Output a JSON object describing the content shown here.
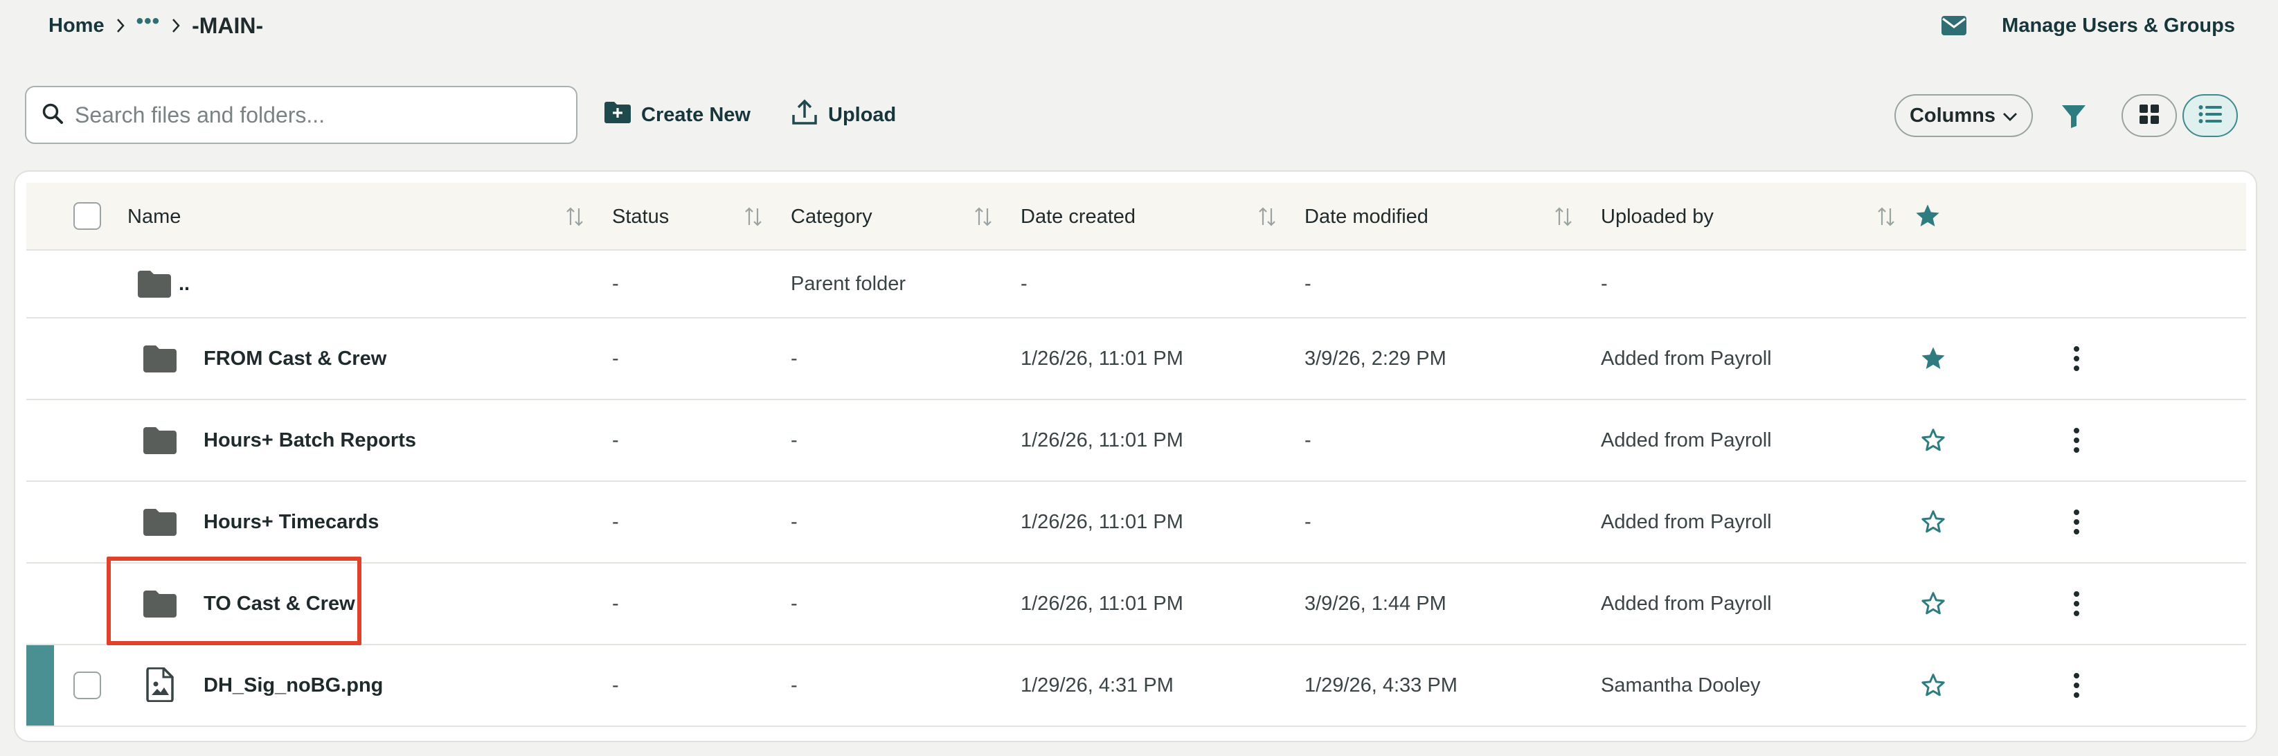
{
  "breadcrumb": {
    "home": "Home",
    "more": "•••",
    "current": "-MAIN-"
  },
  "topright": {
    "manage_label": "Manage Users & Groups",
    "mail_icon": "mail-icon"
  },
  "toolbar": {
    "search_placeholder": "Search files and folders...",
    "create_label": "Create New",
    "upload_label": "Upload",
    "columns_label": "Columns"
  },
  "colors": {
    "accent": "#2f6e72",
    "selected_bar": "#4a9092",
    "highlight": "#e0412b"
  },
  "table": {
    "headers": {
      "name": "Name",
      "status": "Status",
      "category": "Category",
      "date_created": "Date created",
      "date_modified": "Date modified",
      "uploaded_by": "Uploaded by"
    },
    "parent": {
      "name": "..",
      "status": "-",
      "category": "Parent folder",
      "date_created": "-",
      "date_modified": "-",
      "uploaded_by": "-"
    },
    "rows": [
      {
        "name": "FROM Cast & Crew",
        "type": "folder",
        "status": "-",
        "category": "-",
        "date_created": "1/26/26, 11:01 PM",
        "date_modified": "3/9/26, 2:29 PM",
        "uploaded_by": "Added from Payroll",
        "starred": true
      },
      {
        "name": "Hours+ Batch Reports",
        "type": "folder",
        "status": "-",
        "category": "-",
        "date_created": "1/26/26, 11:01 PM",
        "date_modified": "-",
        "uploaded_by": "Added from Payroll",
        "starred": false
      },
      {
        "name": "Hours+ Timecards",
        "type": "folder",
        "status": "-",
        "category": "-",
        "date_created": "1/26/26, 11:01 PM",
        "date_modified": "-",
        "uploaded_by": "Added from Payroll",
        "starred": false
      },
      {
        "name": "TO Cast & Crew",
        "type": "folder",
        "status": "-",
        "category": "-",
        "date_created": "1/26/26, 11:01 PM",
        "date_modified": "3/9/26, 1:44 PM",
        "uploaded_by": "Added from Payroll",
        "starred": false
      },
      {
        "name": "DH_Sig_noBG.png",
        "type": "image",
        "status": "-",
        "category": "-",
        "date_created": "1/29/26, 4:31 PM",
        "date_modified": "1/29/26, 4:33 PM",
        "uploaded_by": "Samantha Dooley",
        "starred": false
      }
    ]
  }
}
